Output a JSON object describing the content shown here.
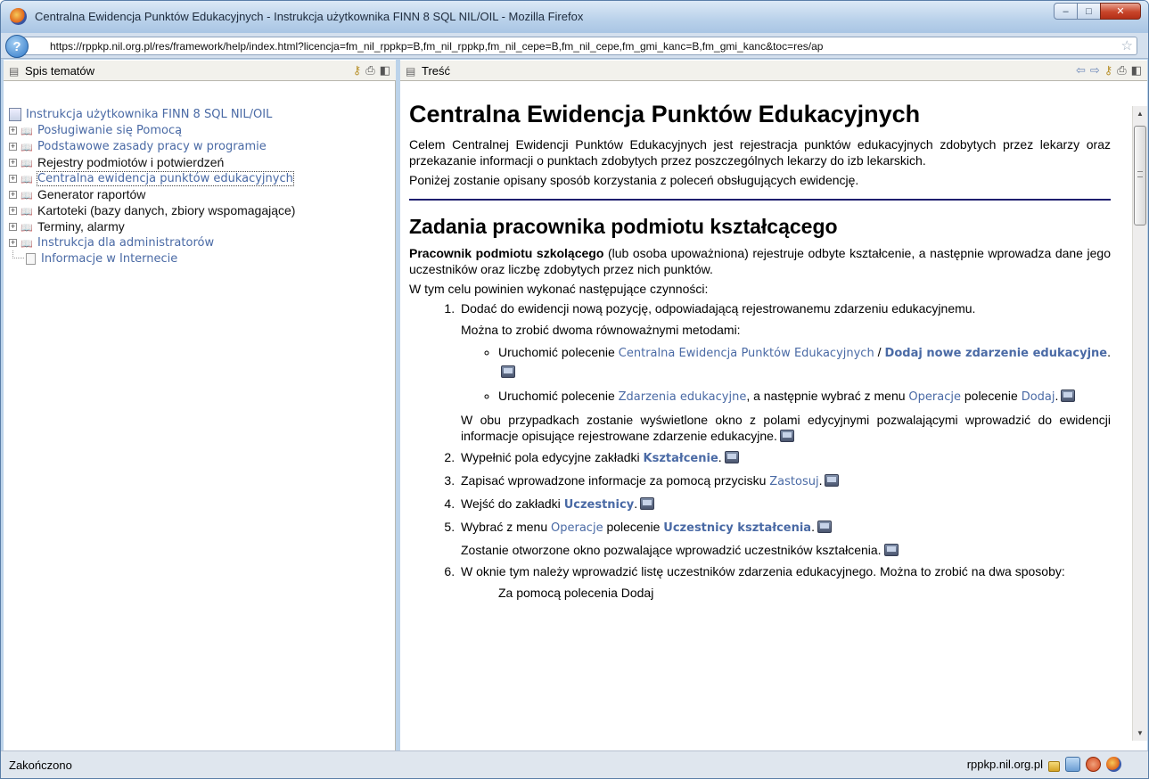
{
  "window": {
    "title": "Centralna Ewidencja Punktów Edukacyjnych - Instrukcja użytkownika FINN 8 SQL NIL/OIL - Mozilla Firefox",
    "minimize": "–",
    "maximize": "□",
    "close": "✕"
  },
  "address": {
    "url": "https://rppkp.nil.org.pl/res/framework/help/index.html?licencja=fm_nil_rppkp=B,fm_nil_rppkp,fm_nil_cepe=B,fm_nil_cepe,fm_gmi_kanc=B,fm_gmi_kanc&toc=res/ap",
    "site_icon": "?"
  },
  "left_pane": {
    "header": "Spis tematów",
    "tree": [
      {
        "label": "Instrukcja użytkownika FINN 8 SQL NIL/OIL",
        "type": "root",
        "style": "link"
      },
      {
        "label": "Posługiwanie się Pomocą",
        "type": "book",
        "style": "link"
      },
      {
        "label": "Podstawowe zasady pracy w programie",
        "type": "book",
        "style": "link"
      },
      {
        "label": "Rejestry podmiotów i potwierdzeń",
        "type": "book",
        "style": "dark"
      },
      {
        "label": "Centralna ewidencja punktów edukacyjnych",
        "type": "book",
        "style": "link",
        "focused": true
      },
      {
        "label": "Generator raportów",
        "type": "book",
        "style": "dark"
      },
      {
        "label": "Kartoteki (bazy danych, zbiory wspomagające)",
        "type": "book",
        "style": "dark"
      },
      {
        "label": "Terminy, alarmy",
        "type": "book",
        "style": "dark"
      },
      {
        "label": "Instrukcja dla administratorów",
        "type": "book",
        "style": "link"
      },
      {
        "label": "Informacje w Internecie",
        "type": "page",
        "style": "link"
      }
    ]
  },
  "right_pane": {
    "header": "Treść",
    "h1": "Centralna Ewidencja Punktów Edukacyjnych",
    "intro1": "Celem Centralnej Ewidencji Punktów Edukacyjnych jest rejestracja punktów edukacyjnych zdobytych przez lekarzy oraz przekazanie informacji o punktach zdobytych przez poszczególnych lekarzy do izb lekarskich.",
    "intro2": "Poniżej zostanie opisany sposób korzystania z poleceń obsługujących ewidencję.",
    "h2": "Zadania pracownika podmiotu kształcącego",
    "p1_bold": "Pracownik podmiotu szkolącego",
    "p1_rest": " (lub osoba upoważniona) rejestruje odbyte kształcenie, a następnie wprowadza dane jego uczestników oraz liczbę zdobytych przez nich punktów.",
    "p2": "W tym celu powinien wykonać następujące czynności:",
    "step1": "Dodać do ewidencji nową pozycję, odpowiadającą rejestrowanemu zdarzeniu edukacyjnemu.",
    "step1_sub": "Można to zrobić dwoma równoważnymi metodami:",
    "b1_pre": "Uruchomić polecenie ",
    "b1_link": "Centralna Ewidencja Punktów Edukacyjnych",
    "b1_sep": " / ",
    "b1_bold": "Dodaj nowe zdarzenie edukacyjne",
    "b1_end": ".",
    "b2_pre": "Uruchomić polecenie ",
    "b2_bold": "Zdarzenia edukacyjne",
    "b2_mid": ", a następnie wybrać z menu ",
    "b2_link": "Operacje",
    "b2_mid2": " polecenie ",
    "b2_bold2": "Dodaj",
    "b2_end": ".",
    "step1_after": "W obu przypadkach zostanie wyświetlone okno z polami edycyjnymi pozwalającymi wprowadzić do ewidencji informacje opisujące rejestrowane zdarzenie edukacyjne.",
    "step2_pre": "Wypełnić pola edycyjne zakładki ",
    "step2_bold": "Kształcenie",
    "step2_end": ".",
    "step3_pre": "Zapisać wprowadzone informacje za pomocą przycisku ",
    "step3_link": "Zastosuj",
    "step3_end": ".",
    "step4_pre": "Wejść do zakładki ",
    "step4_bold": "Uczestnicy",
    "step4_end": ".",
    "step5_pre": "Wybrać z menu ",
    "step5_link": "Operacje",
    "step5_mid": " polecenie ",
    "step5_bold": "Uczestnicy kształcenia",
    "step5_end": ".",
    "step5_sub": "Zostanie otworzone okno pozwalające wprowadzić uczestników kształcenia.",
    "step6": "W oknie tym należy wprowadzić listę uczestników zdarzenia edukacyjnego. Można to zrobić na dwa sposoby:",
    "step6_cut": "Za pomocą polecenia Dodaj"
  },
  "status": {
    "text": "Zakończono",
    "host": "rppkp.nil.org.pl"
  },
  "colors": {
    "link": "#4a6aa5",
    "rule": "#1e1e6e"
  }
}
